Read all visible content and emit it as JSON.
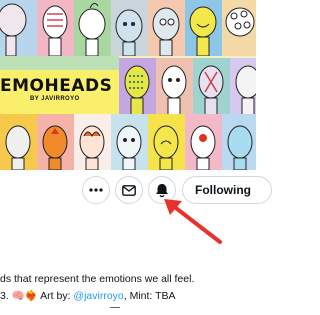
{
  "banner": {
    "title": "EMOHEADS",
    "subtitle": "BY JAVIRROYO"
  },
  "actions": {
    "more_icon": "more-horizontal-icon",
    "message_icon": "envelope-icon",
    "notify_icon": "bell-icon",
    "follow_label": "Following"
  },
  "bio": {
    "line1": "ds that represent the emotions we all feel.",
    "line2_prefix": "3. 🧠❤️‍🔥 Art by: ",
    "line2_handle": "@javirroyo",
    "line2_suffix": ", Mint: TBA"
  },
  "colors": {
    "annotation_arrow": "#e8312a",
    "link": "#1d9bf0",
    "banner_yellow": "#f9ef6a"
  }
}
